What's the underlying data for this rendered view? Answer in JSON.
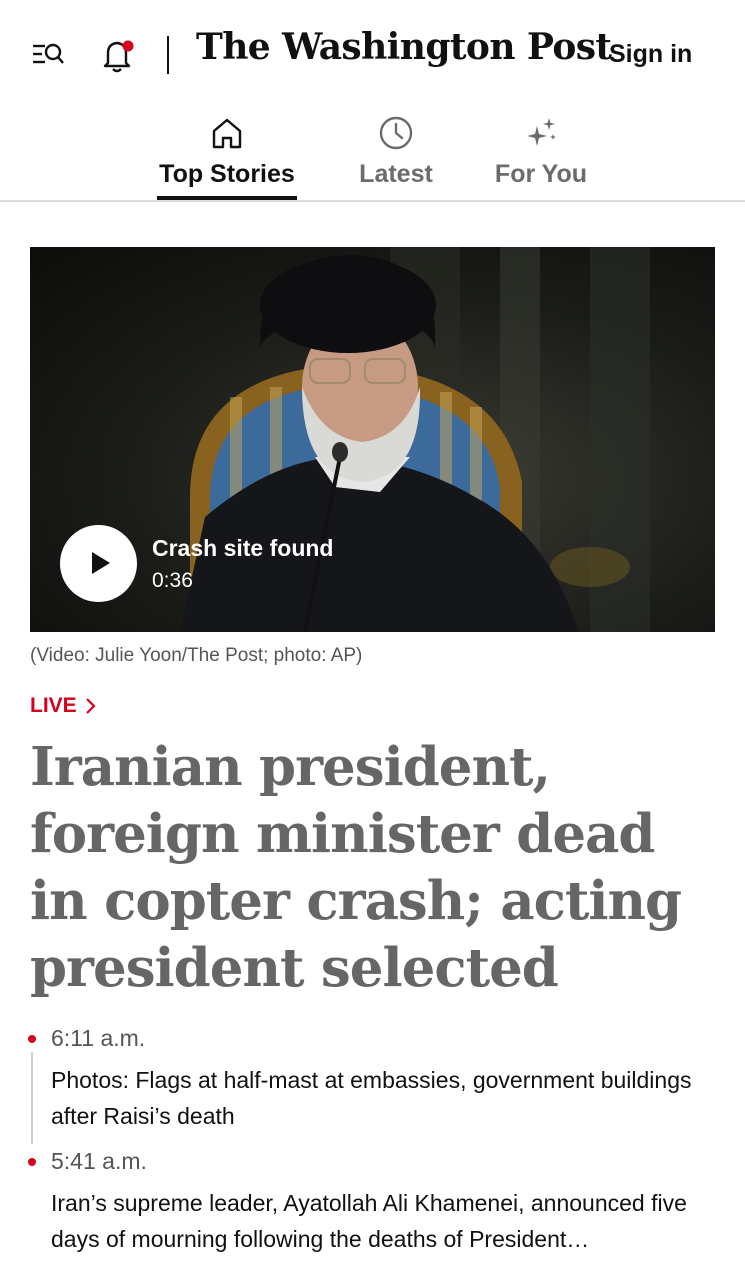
{
  "header": {
    "menu_icon": "menu-search-icon",
    "bell_icon": "bell-notification-icon",
    "masthead": "The Washington Post",
    "sign_in_label": "Sign in"
  },
  "tabs": [
    {
      "label": "Top Stories",
      "icon": "home-icon",
      "active": true
    },
    {
      "label": "Latest",
      "icon": "clock-icon",
      "active": false
    },
    {
      "label": "For You",
      "icon": "sparkles-icon",
      "active": false
    }
  ],
  "video": {
    "title": "Crash site found",
    "duration": "0:36",
    "caption": "(Video: Julie Yoon/The Post; photo: AP)"
  },
  "story": {
    "live_label": "LIVE",
    "headline": "Iranian president, foreign minister dead in copter crash; acting president selected"
  },
  "timeline": [
    {
      "time": "6:11 a.m.",
      "text": "Photos: Flags at half-mast at embassies, government buildings after Raisi’s death"
    },
    {
      "time": "5:41 a.m.",
      "text": "Iran’s supreme leader, Ayatollah Ali Khamenei, announced five days of mourning following the deaths of President…"
    }
  ],
  "colors": {
    "accent_red": "#d4021d",
    "headline_gray": "#666666",
    "text_dark": "#111111"
  }
}
